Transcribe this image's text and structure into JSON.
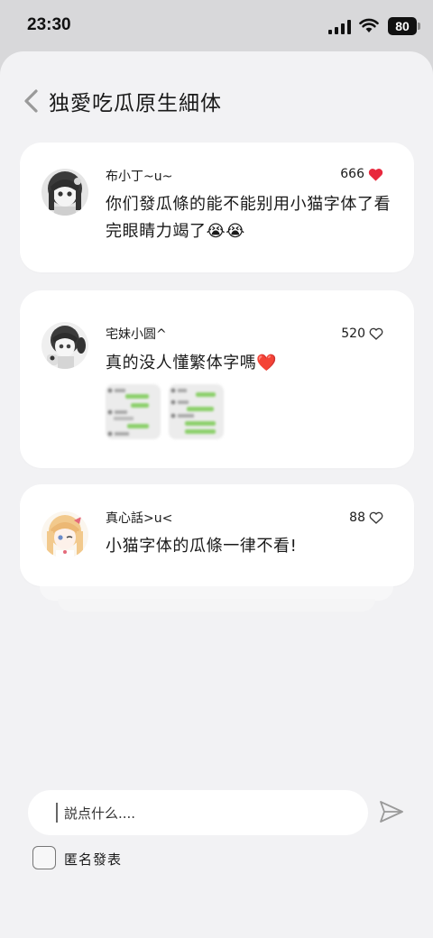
{
  "status_bar": {
    "time": "23:30",
    "battery": "80",
    "icons": [
      "signal-icon",
      "wifi-icon",
      "battery-icon"
    ]
  },
  "header": {
    "back_icon": "chevron-left-icon",
    "title": "独愛吃瓜原生細体"
  },
  "comments": [
    {
      "username": "布小丁~u~",
      "likes": "666",
      "liked": true,
      "text": "你们發瓜條的能不能别用小猫字体了看完眼睛力竭了😭😭"
    },
    {
      "username": "宅妹小圆^",
      "likes": "520",
      "liked": false,
      "text": "真的没人懂繁体字嗎❤️"
    },
    {
      "username": "真心話>u<",
      "likes": "88",
      "liked": false,
      "text": "小猫字体的瓜條一律不看!"
    }
  ],
  "composer": {
    "placeholder": "説点什么....",
    "send_icon": "send-icon",
    "anonymous_label": "匿名發表",
    "anonymous_checked": false
  },
  "colors": {
    "background": "#f2f2f4",
    "card": "#ffffff",
    "liked_heart": "#e8283d",
    "status_bar": "#d8d8da"
  }
}
